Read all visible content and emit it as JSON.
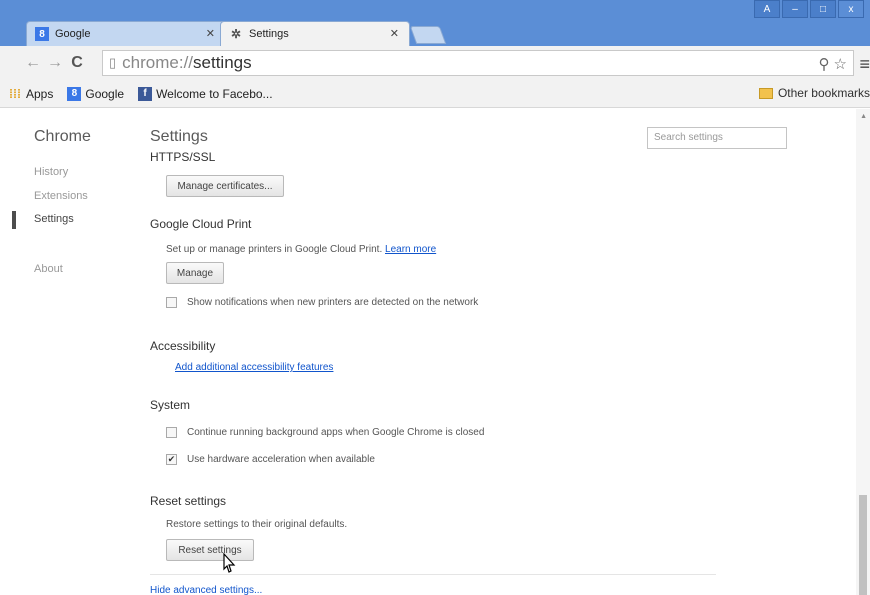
{
  "tabs": [
    {
      "title": "Google",
      "favicon": "google-favicon"
    },
    {
      "title": "Settings",
      "favicon": "gear-icon"
    }
  ],
  "window_buttons": [
    "A",
    "–",
    "□",
    "x"
  ],
  "toolbar": {
    "url_prefix": "chrome://",
    "url_path": "settings"
  },
  "bookmarks": {
    "items": [
      {
        "label": "Apps",
        "icon": "apps-icon"
      },
      {
        "label": "Google",
        "icon": "google-favicon"
      },
      {
        "label": "Welcome to Facebo...",
        "icon": "facebook-icon"
      }
    ],
    "other": "Other bookmarks"
  },
  "sidebar": {
    "title": "Chrome",
    "items": [
      "History",
      "Extensions",
      "Settings",
      "About"
    ]
  },
  "main": {
    "title": "Settings",
    "search_placeholder": "Search settings",
    "https": {
      "title": "HTTPS/SSL",
      "button": "Manage certificates..."
    },
    "cloud_print": {
      "title": "Google Cloud Print",
      "desc": "Set up or manage printers in Google Cloud Print.",
      "link": "Learn more",
      "button": "Manage",
      "checkbox": "Show notifications when new printers are detected on the network"
    },
    "accessibility": {
      "title": "Accessibility",
      "link": "Add additional accessibility features"
    },
    "system": {
      "title": "System",
      "check1": "Continue running background apps when Google Chrome is closed",
      "check2": "Use hardware acceleration when available"
    },
    "reset": {
      "title": "Reset settings",
      "desc": "Restore settings to their original defaults.",
      "button": "Reset settings"
    },
    "hide_link": "Hide advanced settings..."
  },
  "colors": {
    "titlebar": "#5b8ed6",
    "link": "#1155cc"
  }
}
